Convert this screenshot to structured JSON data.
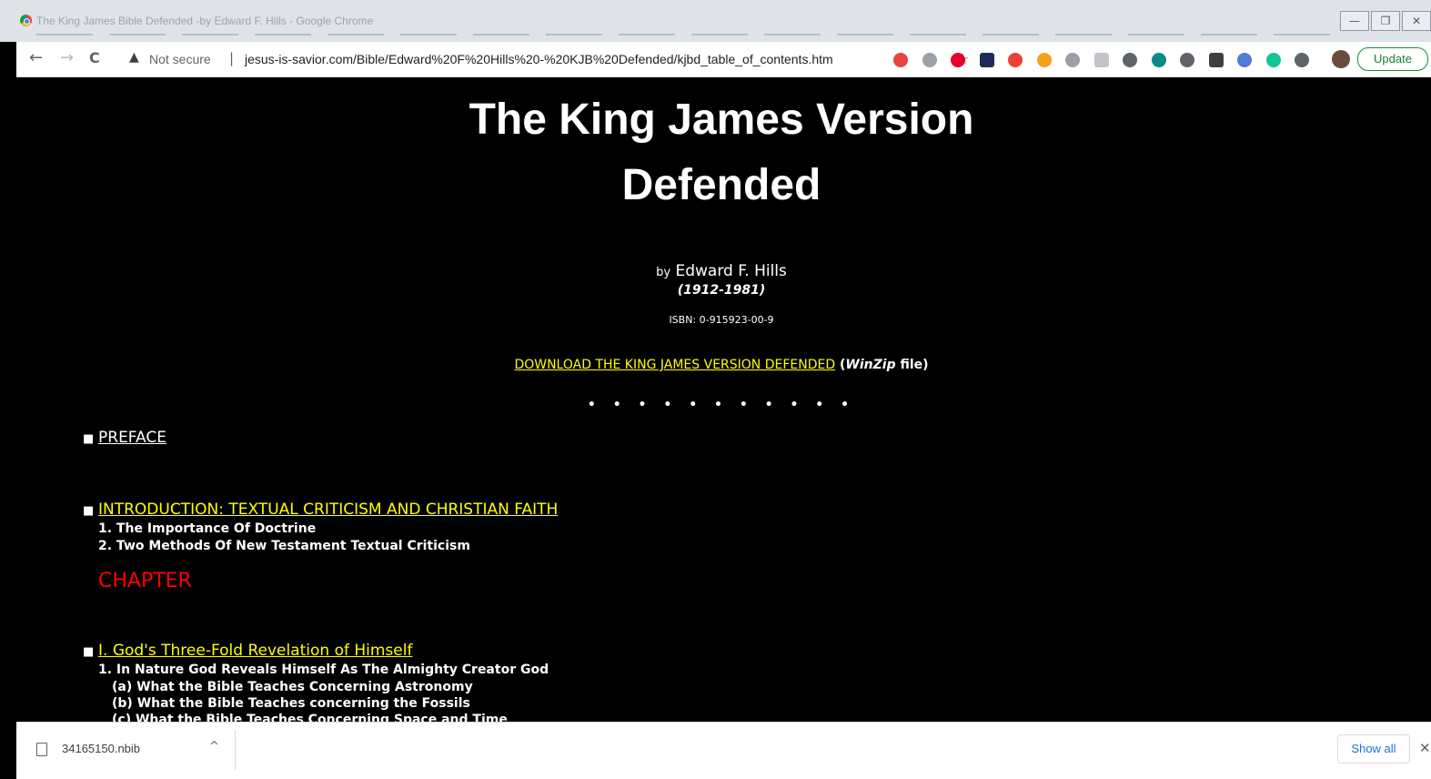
{
  "window": {
    "title": "The King James Bible Defended -by Edward F. Hills - Google Chrome",
    "min": "—",
    "max": "❐",
    "close": "✕"
  },
  "toolbar": {
    "back": "←",
    "forward": "→",
    "reload": "C",
    "warning": "▲",
    "security": "Not secure",
    "separator": "|",
    "url": "jesus-is-savior.com/Bible/Edward%20F%20Hills%20-%20KJB%20Defended/kjbd_table_of_contents.htm",
    "star": "☆",
    "update": "Update",
    "menu": "⋮",
    "extensions": [
      {
        "name": "ext-blue-red-icon",
        "color": "#e8453c"
      },
      {
        "name": "ext-dropbox-icon",
        "color": "#9aa0a6"
      },
      {
        "name": "ext-opera-icon",
        "color": "#e4002b"
      },
      {
        "name": "ext-stripe-icon",
        "color": "#1d2b5a"
      },
      {
        "name": "ext-gmail-icon",
        "color": "#ea4335"
      },
      {
        "name": "ext-coin-icon",
        "color": "#f7a21b"
      },
      {
        "name": "ext-camera-icon",
        "color": "#9aa0a6"
      },
      {
        "name": "ext-frame-icon",
        "color": "#c0c4c9"
      },
      {
        "name": "ext-dot-icon",
        "color": "#5f6368"
      },
      {
        "name": "ext-grammar-icon",
        "color": "#0b8a8a"
      },
      {
        "name": "ext-screenshot-icon",
        "color": "#5f6368"
      },
      {
        "name": "ext-new-icon",
        "color": "#3c4043"
      },
      {
        "name": "ext-glasses-icon",
        "color": "#4f7bd8"
      },
      {
        "name": "ext-grammarly-icon",
        "color": "#15c39a"
      },
      {
        "name": "ext-puzzle-icon",
        "color": "#5f6368"
      }
    ]
  },
  "page": {
    "title_line1": "The King James Version",
    "title_line2": "Defended",
    "by": "by",
    "author": "Edward F. Hills",
    "dates": "(1912-1981)",
    "isbn": "ISBN: 0-915923-00-9",
    "download_link": "DOWNLOAD THE KING JAMES VERSION DEFENDED",
    "download_pre": "(",
    "download_italic": "WinZip",
    "download_post": "file)",
    "dots": "• • • • • • • • • • •",
    "preface": "PREFACE",
    "intro": "INTRODUCTION: TEXTUAL CRITICISM AND CHRISTIAN FAITH",
    "intro_items": [
      "1. The Importance Of Doctrine",
      "2. Two Methods Of New Testament Textual Criticism"
    ],
    "chapter_label": "CHAPTER",
    "ch1": "I. God's Three-Fold Revelation of Himself",
    "ch1_item1": "1. In Nature God Reveals Himself As The Almighty Creator God",
    "ch1_subs": [
      "(a) What the Bible Teaches Concerning Astronomy",
      "(b) What the Bible Teaches concerning the Fossils",
      "(c) What the Bible Teaches Concerning Space and Time"
    ]
  },
  "downloads": {
    "file": "34165150.nbib",
    "chevron": "^",
    "show_all": "Show all",
    "close": "✕"
  }
}
